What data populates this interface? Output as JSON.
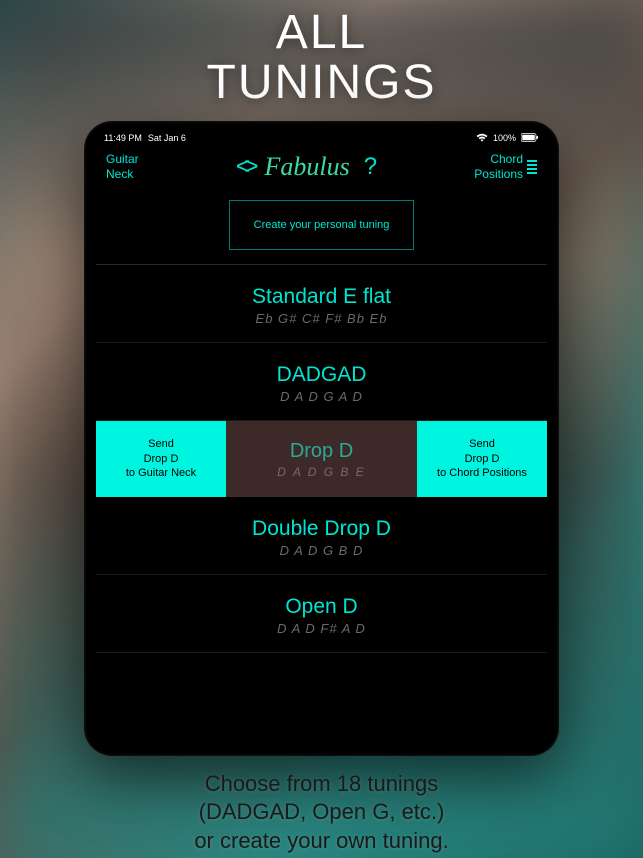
{
  "headline": {
    "line1": "ALL",
    "line2": "TUNINGS"
  },
  "status_bar": {
    "time": "11:49 PM",
    "date": "Sat Jan 6",
    "battery": "100%"
  },
  "header": {
    "left_label": "Guitar\nNeck",
    "app_title": "Fabulus",
    "right_label": "Chord\nPositions"
  },
  "create_button": "Create your personal tuning",
  "tunings": [
    {
      "name": "Standard E flat",
      "notes": "Eb G# C# F# Bb Eb",
      "selected": false
    },
    {
      "name": "DADGAD",
      "notes": "D A D G A D",
      "selected": false
    },
    {
      "name": "Drop D",
      "notes": "D A D G B E",
      "selected": true,
      "send_left": "Send\nDrop D\nto Guitar Neck",
      "send_right": "Send\nDrop D\nto Chord Positions"
    },
    {
      "name": "Double Drop D",
      "notes": "D A D G B D",
      "selected": false
    },
    {
      "name": "Open D",
      "notes": "D A D F# A D",
      "selected": false
    }
  ],
  "footer": {
    "line1": "Choose from 18 tunings",
    "line2": "(DADGAD, Open G, etc.)",
    "line3": "or create your own tuning."
  }
}
